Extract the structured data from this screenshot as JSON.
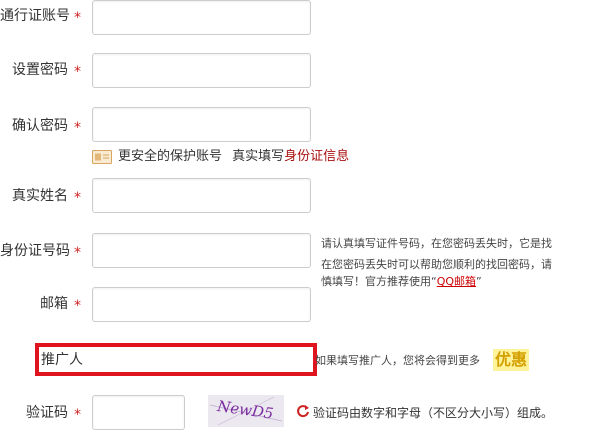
{
  "form": {
    "required_mark": "*",
    "account": {
      "label": "通行证账号"
    },
    "password": {
      "label": "设置密码"
    },
    "confirm": {
      "label": "确认密码"
    },
    "safer": {
      "lead": "更安全的保护账号",
      "prefix": "真实填写",
      "emphasis": "身份证信息"
    },
    "realname": {
      "label": "真实姓名"
    },
    "idcard": {
      "label": "身份证号码",
      "hint1": "请认真填写证件号码，在您密码丢失时，它是找",
      "hint2": "在您密码丢失时可以帮助您顺利的找回密码，请",
      "hint3_prefix": "慎填写！官方推荐使用“",
      "hint3_link": "QQ邮箱",
      "hint3_suffix": "”"
    },
    "email": {
      "label": "邮箱"
    },
    "referrer": {
      "label": "推广人",
      "hint": "如果填写推广人，您将会得到更多",
      "badge": "优惠"
    },
    "captcha": {
      "label": "验证码",
      "image_text": "NewD5",
      "refresh_icon": "refresh-icon",
      "hint": "验证码由数字和字母（不区分大小写）组成。"
    }
  },
  "colors": {
    "required": "#cc2222",
    "highlight_border": "#e0141e",
    "badge": "#d4a000"
  }
}
